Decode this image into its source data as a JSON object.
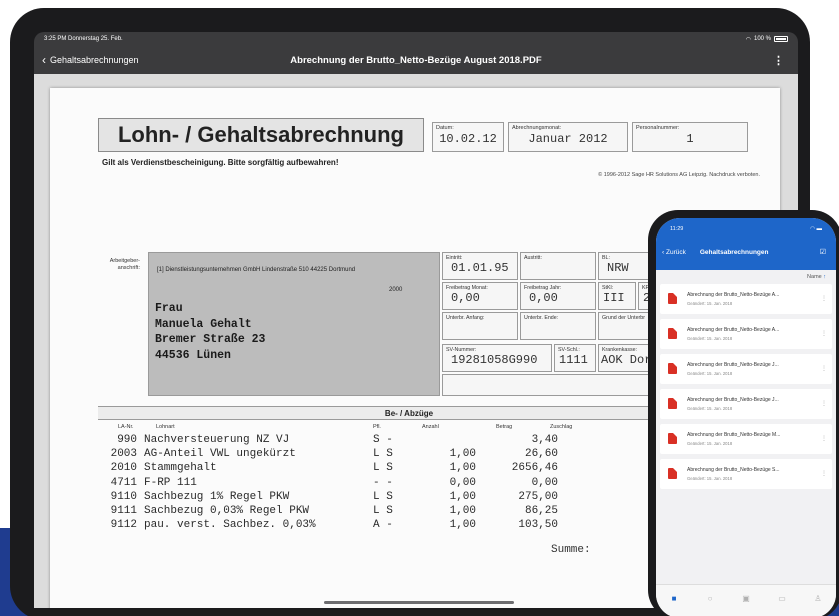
{
  "ipad": {
    "status_time": "3:25 PM  Donnerstag 25. Feb.",
    "status_right": "100 %",
    "back_label": "Gehaltsabrechnungen",
    "title": "Abrechnung der Brutto_Netto-Bezüge August 2018.PDF",
    "more": "⋮"
  },
  "doc": {
    "title": "Lohn- / Gehaltsabrechnung",
    "datum_label": "Datum:",
    "datum_value": "10.02.12",
    "monat_label": "Abrechnungsmonat:",
    "monat_value": "Januar 2012",
    "pnr_label": "Personalnummer:",
    "pnr_value": "1",
    "subtitle": "Gilt als Verdienstbescheinigung. Bitte sorgfältig aufbewahren!",
    "copyright": "© 1996-2012 Sage HR Solutions AG Leipzig. Nachdruck verboten.",
    "employer_label": "Arbeitgeber-anschrift:",
    "employer_line": "[1] Dienstleistungsunternehmen GmbH  Lindenstraße 510 44225 Dortmund",
    "employer_line2": "2000",
    "address": [
      "Frau",
      "Manuela Gehalt",
      "Bremer Straße 23",
      "44536 Lünen"
    ],
    "fields": {
      "eintritt_label": "Eintritt:",
      "eintritt_value": "01.01.95",
      "austritt_label": "Austritt:",
      "bl_label": "BL:",
      "bl_value": "NRW",
      "fb_monat_label": "Freibetrag Monat:",
      "fb_monat_value": "0,00",
      "fb_jahr_label": "Freibetrag Jahr:",
      "fb_jahr_value": "0,00",
      "stkl_label": "StKl:",
      "stkl_value": "III",
      "kfb_label": "KFB:",
      "kfb_value": "2",
      "unterbr_anfang_label": "Unterbr. Anfang:",
      "unterbr_ende_label": "Unterbr. Ende:",
      "grund_label": "Grund der Unterbr",
      "sv_label": "SV-Nummer:",
      "sv_value": "19281058G990",
      "svschl_label": "SV-Schl.:",
      "svschl_value": "1111",
      "kk_label": "Krankenkasse:",
      "kk_value": "AOK Dort"
    },
    "deductions_title": "Be- / Abzüge",
    "columns": [
      "LA-Nr.",
      "Lohnart",
      "Pfl.",
      "Anzahl",
      "Betrag",
      "Zuschlag"
    ],
    "rows": [
      {
        "nr": "990",
        "art": "Nachversteuerung NZ VJ",
        "pfl": "S -",
        "anz": "",
        "betrag": "3,40"
      },
      {
        "nr": "2003",
        "art": "AG-Anteil VWL ungekürzt",
        "pfl": "L S",
        "anz": "1,00",
        "betrag": "26,60"
      },
      {
        "nr": "2010",
        "art": "Stammgehalt",
        "pfl": "L S",
        "anz": "1,00",
        "betrag": "2656,46"
      },
      {
        "nr": "4711",
        "art": "F-RP 111",
        "pfl": "- -",
        "anz": "0,00",
        "betrag": "0,00"
      },
      {
        "nr": "9110",
        "art": "Sachbezug 1% Regel PKW",
        "pfl": "L S",
        "anz": "1,00",
        "betrag": "275,00"
      },
      {
        "nr": "9111",
        "art": "Sachbezug 0,03% Regel PKW",
        "pfl": "L S",
        "anz": "1,00",
        "betrag": "86,25"
      },
      {
        "nr": "9112",
        "art": "pau. verst. Sachbez. 0,03%",
        "pfl": "A -",
        "anz": "1,00",
        "betrag": "103,50"
      }
    ],
    "summe_label": "Summe:"
  },
  "iphone": {
    "time": "11:29",
    "back": "Zurück",
    "title": "Gehaltsabrechnungen",
    "sort_label": "Name",
    "items": [
      {
        "name": "Abrechnung der Brutto_Netto-Bezüge A...",
        "date": "Geändert: 15. Jan. 2018"
      },
      {
        "name": "Abrechnung der Brutto_Netto-Bezüge A...",
        "date": "Geändert: 15. Jan. 2018"
      },
      {
        "name": "Abrechnung der Brutto_Netto-Bezüge J...",
        "date": "Geändert: 15. Jan. 2018"
      },
      {
        "name": "Abrechnung der Brutto_Netto-Bezüge J...",
        "date": "Geändert: 15. Jan. 2018"
      },
      {
        "name": "Abrechnung der Brutto_Netto-Bezüge M...",
        "date": "Geändert: 15. Jan. 2018"
      },
      {
        "name": "Abrechnung der Brutto_Netto-Bezüge S...",
        "date": "Geändert: 15. Jan. 2018"
      }
    ],
    "accent": "#1e66c9"
  },
  "icons": {
    "back": "chevron-left-icon",
    "more": "more-vertical-icon",
    "pdf": "pdf-file-icon",
    "wifi": "wifi-icon",
    "battery": "battery-icon",
    "edit": "edit-icon"
  }
}
